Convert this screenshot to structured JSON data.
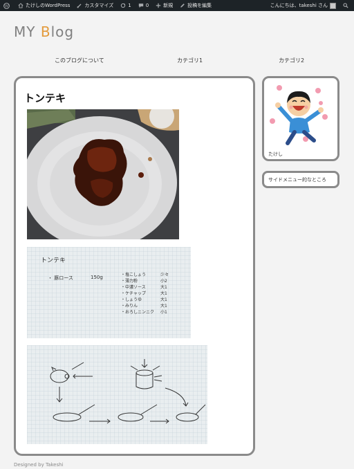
{
  "adminbar": {
    "site_name": "たけしのWordPress",
    "customize": "カスタマイズ",
    "updates": "1",
    "comments": "0",
    "new": "新規",
    "edit_post": "投稿を編集",
    "greeting": "こんにちは、takeshi さん"
  },
  "header": {
    "title_part1": "MY ",
    "title_accent": "B",
    "title_part2": "log"
  },
  "nav": {
    "items": [
      "このブログについて",
      "カテゴリ1",
      "カテゴリ2"
    ]
  },
  "post": {
    "title": "トンテキ"
  },
  "recipe": {
    "title": "トンテキ",
    "main_item": "・ 豚ロース",
    "main_qty": "150g",
    "ingredients": [
      "・塩こしょう",
      "・薄力粉",
      "・中濃ソース",
      "・ケチャップ",
      "・しょうゆ",
      "・みりん",
      "・おろしニンニク"
    ],
    "amounts": [
      "少々",
      "小2",
      "大1",
      "大1",
      "大1",
      "大1",
      "小1"
    ]
  },
  "sidebar": {
    "profile_name": "たけし",
    "menu_text": "サイドメニュー的なところ"
  },
  "footer": {
    "text": "Designed by Takeshi"
  },
  "colors": {
    "adminbar_bg": "#1d2327",
    "accent": "#e39a3b",
    "card_border": "#8a8a8a"
  }
}
